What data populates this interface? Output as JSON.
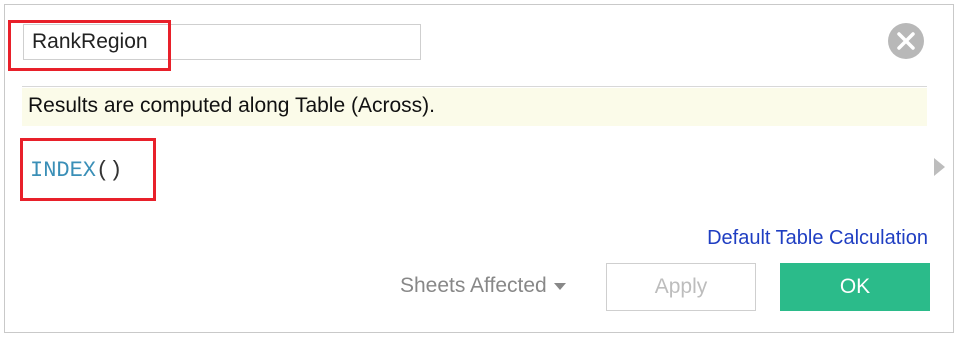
{
  "calc_name": {
    "value": "RankRegion"
  },
  "info_bar": {
    "text": "Results are computed along Table (Across)."
  },
  "formula": {
    "function": "INDEX",
    "args": "()"
  },
  "links": {
    "default_table_calculation": "Default Table Calculation"
  },
  "footer": {
    "sheets_affected_label": "Sheets Affected",
    "apply_label": "Apply",
    "ok_label": "OK"
  },
  "icons": {
    "close": "close-icon",
    "expand": "expand-arrow-icon",
    "dropdown": "chevron-down-icon"
  },
  "colors": {
    "ok_button": "#2bbb8a",
    "highlight": "#e8202a",
    "link": "#1f3ec2",
    "function_keyword": "#3a8fb7",
    "info_bar_bg": "#fbfbe9"
  }
}
